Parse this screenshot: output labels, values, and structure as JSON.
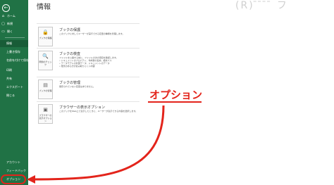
{
  "sidebar": {
    "back_glyph": "←",
    "back_label": "back",
    "top_items": [
      {
        "icon": "home-icon",
        "glyph": "⌂",
        "label": "ホーム"
      },
      {
        "icon": "new-file-icon",
        "glyph": "▢",
        "label": "新規"
      },
      {
        "icon": "open-folder-icon",
        "glyph": "▭",
        "label": "開く"
      }
    ],
    "mid_items": [
      {
        "label": "情報",
        "active": true
      },
      {
        "label": "上書き保存"
      },
      {
        "label": "名前を付けて保存"
      },
      {
        "label": "印刷"
      },
      {
        "label": "共有"
      },
      {
        "label": "エクスポート"
      },
      {
        "label": "閉じる"
      }
    ],
    "bottom_items": [
      {
        "label": "アカウント"
      },
      {
        "label": "フィードバック"
      },
      {
        "label": "オプション"
      }
    ]
  },
  "header": {
    "title": "情報",
    "faded_text": "(R) ̄ ̄ ̄ ̄ フ"
  },
  "cards": [
    {
      "button_icon": "lock-icon",
      "button_glyph": "🔒",
      "button_label": "ブックの保護",
      "title": "ブックの保護",
      "desc": "このブックに対してユーザーが実行できる変更の種類を管理します。",
      "bullets": []
    },
    {
      "button_icon": "inspect-icon",
      "button_glyph": "🔍",
      "button_label": "問題のチェック",
      "title": "ブックの検査",
      "desc": "ファイルを公開する前に、ファイルの次の項目を確認します。",
      "bullets": [
        "ドキュメントのプロパティ、作成者の名前、絶対パス",
        "データモデルの外部データ、ドキュメントのデータ",
        "障害のある方が読み取りにくい内容"
      ]
    },
    {
      "button_icon": "manage-book-icon",
      "button_glyph": "▤",
      "button_label": "ブックの管理",
      "title": "ブックの管理",
      "desc": "保存されていない変更はありません。",
      "bullets": []
    },
    {
      "button_icon": "browser-view-icon",
      "button_glyph": "▣",
      "button_label": "ブラウザーの表示オプション",
      "title": "ブラウザーの表示オプション",
      "desc": "このブックをWeb上で表示したときに、ユーザーが表示できる内容を選択します。",
      "bullets": []
    }
  ],
  "annotation": {
    "callout_text": "オプション",
    "color": "#e3241b"
  },
  "colors": {
    "sidebar_bg": "#207245",
    "sidebar_active": "#185c37"
  }
}
